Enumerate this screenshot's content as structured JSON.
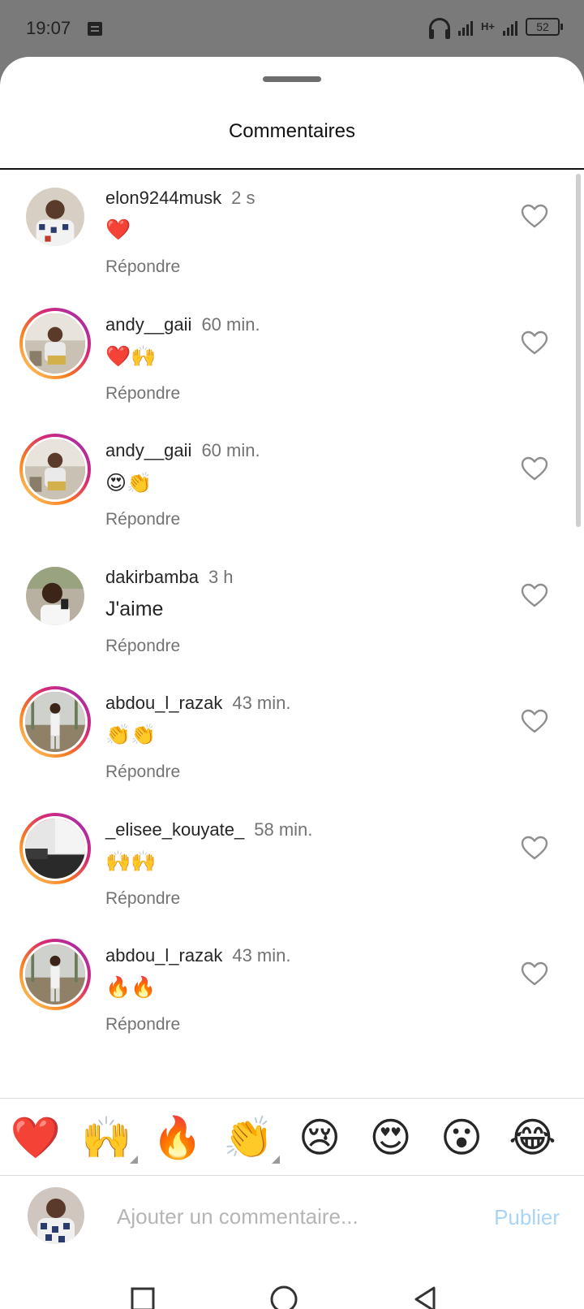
{
  "status_bar": {
    "time": "19:07",
    "network": "H+",
    "battery": "52"
  },
  "sheet": {
    "title": "Commentaires"
  },
  "comments": [
    {
      "username": "elon9244musk",
      "time": "2 s",
      "text": "❤️",
      "reply": "Répondre",
      "story_ring": false,
      "photo": "a"
    },
    {
      "username": "andy__gaii",
      "time": "60 min.",
      "text": "❤️🙌",
      "reply": "Répondre",
      "story_ring": true,
      "photo": "b"
    },
    {
      "username": "andy__gaii",
      "time": "60 min.",
      "text": "😍👏",
      "reply": "Répondre",
      "story_ring": true,
      "photo": "b"
    },
    {
      "username": "dakirbamba",
      "time": "3 h",
      "text": "J'aime",
      "reply": "Répondre",
      "story_ring": false,
      "photo": "c"
    },
    {
      "username": "abdou_l_razak",
      "time": "43 min.",
      "text": "👏👏",
      "reply": "Répondre",
      "story_ring": true,
      "photo": "d"
    },
    {
      "username": "_elisee_kouyate_",
      "time": "58 min.",
      "text": "🙌🙌",
      "reply": "Répondre",
      "story_ring": true,
      "photo": "e"
    },
    {
      "username": "abdou_l_razak",
      "time": "43 min.",
      "text": "🔥🔥",
      "reply": "Répondre",
      "story_ring": true,
      "photo": "d"
    }
  ],
  "quick_reactions": [
    "❤️",
    "🙌",
    "🔥",
    "👏",
    "😢",
    "😍",
    "😮",
    "😂"
  ],
  "composer": {
    "placeholder": "Ajouter un commentaire...",
    "publish_label": "Publier"
  },
  "colors": {
    "link_disabled": "#a8d5f7",
    "secondary_text": "#737373",
    "ring_start": "#feda75",
    "ring_end": "#962fbf"
  },
  "icons": {
    "like": "heart-outline-icon",
    "nav": [
      "recent-apps-icon",
      "home-icon",
      "back-icon"
    ]
  }
}
